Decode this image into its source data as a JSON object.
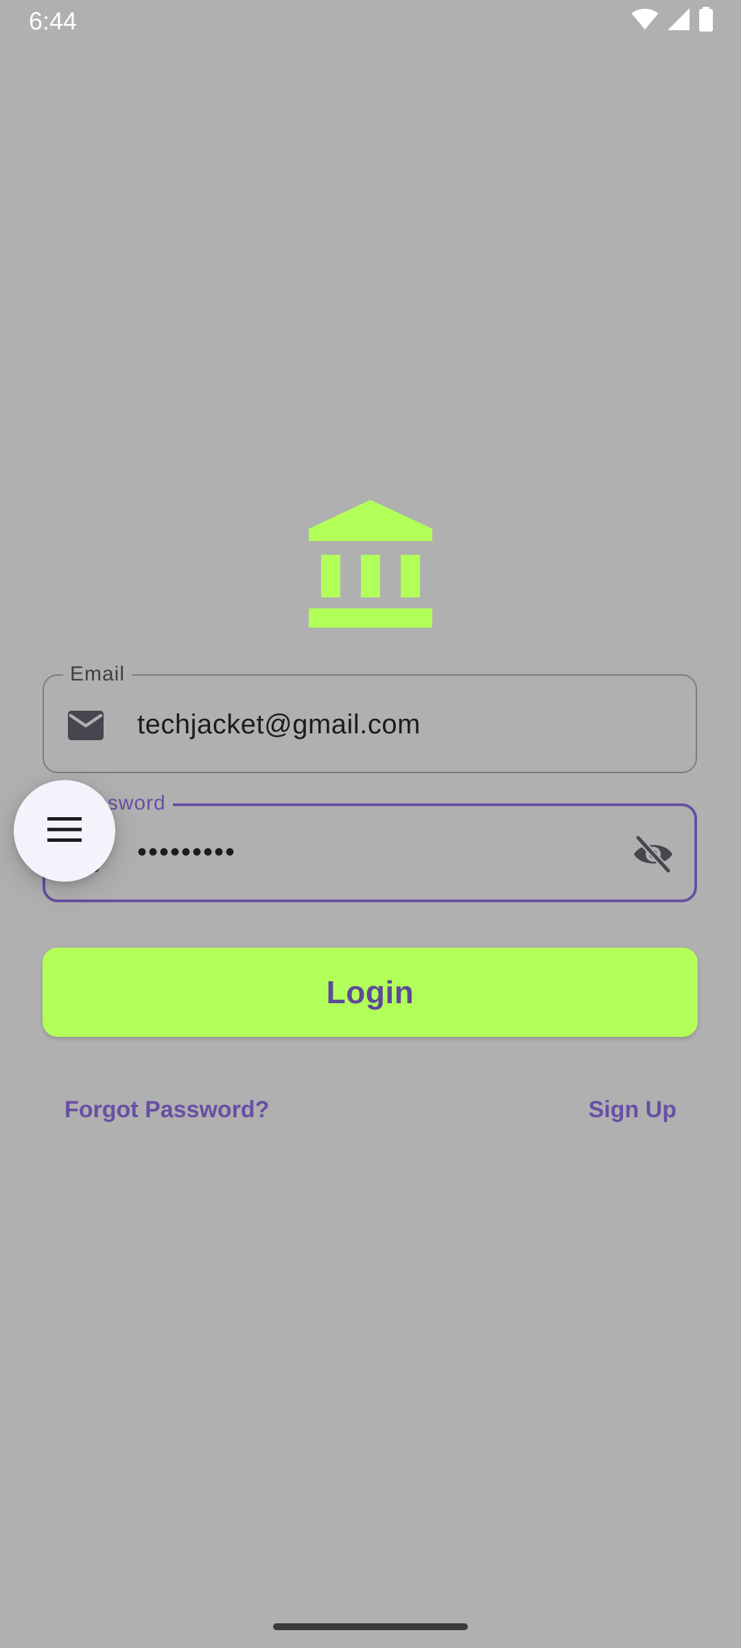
{
  "status_bar": {
    "time": "6:44",
    "icons": [
      "wifi-icon",
      "cellular-signal-icon",
      "battery-icon"
    ]
  },
  "logo": {
    "icon": "bank-icon",
    "color": "#b2ff59"
  },
  "email_field": {
    "label": "Email",
    "value": "techjacket@gmail.com",
    "leading_icon": "mail-icon"
  },
  "password_field": {
    "label": "Password",
    "value": "•••••••••",
    "leading_icon": "lock-icon",
    "trailing_icon": "visibility-off-icon"
  },
  "fab": {
    "icon": "menu-icon"
  },
  "login_button": {
    "label": "Login"
  },
  "links": {
    "forgot_password": "Forgot Password?",
    "sign_up": "Sign Up"
  },
  "colors": {
    "background": "#b0b0b0",
    "accent": "#6750a4",
    "lime": "#b2ff59"
  }
}
